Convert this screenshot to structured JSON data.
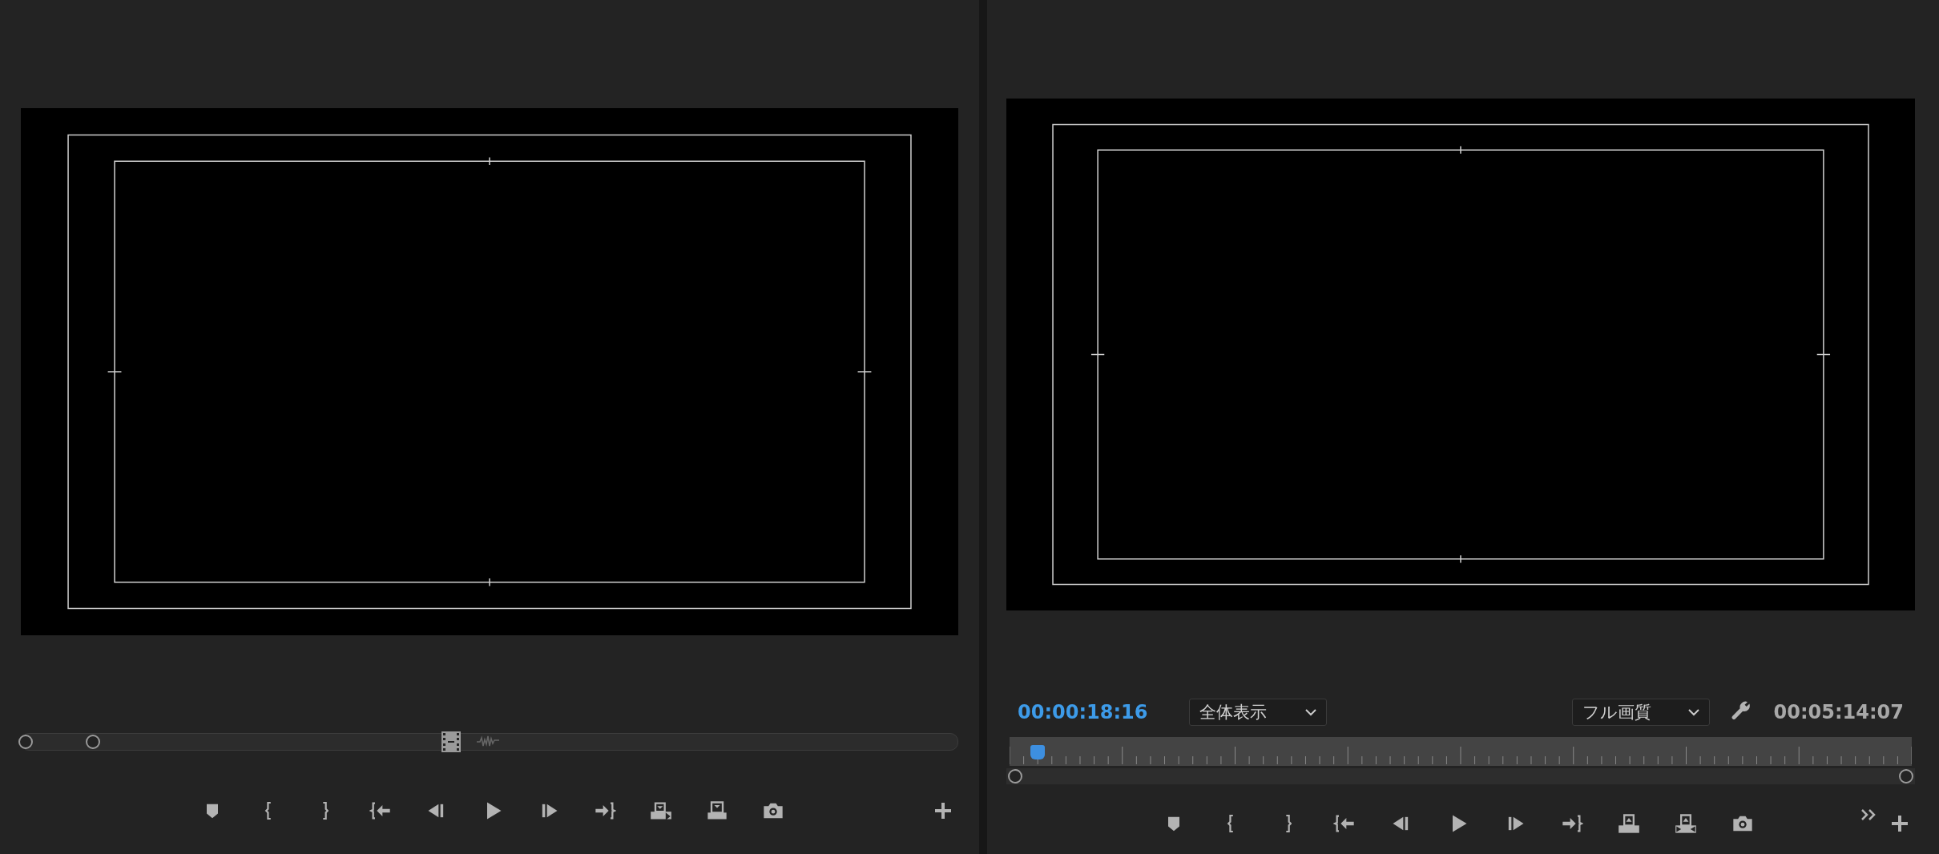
{
  "source_monitor": {
    "buttons": [
      {
        "kind": "marker"
      },
      {
        "kind": "mark-in"
      },
      {
        "kind": "mark-out"
      },
      {
        "kind": "go-to-in"
      },
      {
        "kind": "step-back"
      },
      {
        "kind": "play"
      },
      {
        "kind": "step-forward"
      },
      {
        "kind": "go-to-out"
      },
      {
        "kind": "insert"
      },
      {
        "kind": "overwrite"
      },
      {
        "kind": "export-frame"
      }
    ]
  },
  "program_monitor": {
    "timecode": "00:00:18:16",
    "zoom_select": "全体表示",
    "quality_select": "フル画質",
    "duration": "00:05:14:07",
    "playhead": {
      "level": 0.03
    },
    "buttons": [
      {
        "kind": "marker"
      },
      {
        "kind": "mark-in"
      },
      {
        "kind": "mark-out"
      },
      {
        "kind": "go-to-in"
      },
      {
        "kind": "step-back"
      },
      {
        "kind": "play"
      },
      {
        "kind": "step-forward"
      },
      {
        "kind": "go-to-out"
      },
      {
        "kind": "lift"
      },
      {
        "kind": "extract"
      },
      {
        "kind": "export-frame"
      }
    ]
  }
}
